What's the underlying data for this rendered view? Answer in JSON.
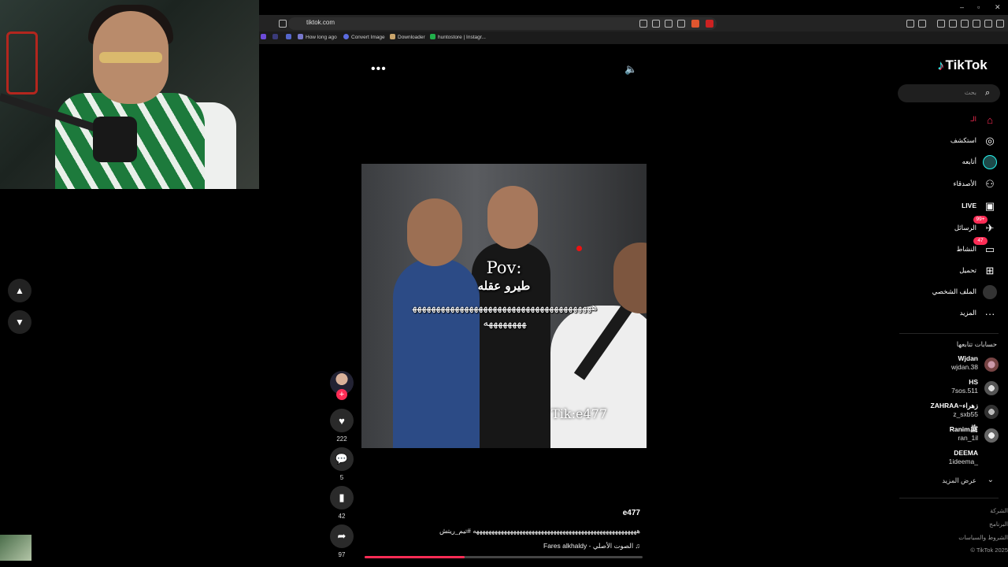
{
  "browser": {
    "url": "tiktok.com",
    "bookmarks": [
      "How long ago",
      "Convert Image",
      "Downloader",
      "huntostore | Instagr..."
    ]
  },
  "video": {
    "overlay_pov": "Pov:",
    "overlay_caption": "طيرو عقله",
    "overlay_laugh": "هههههههههههههههههههههههههههههههههههههههههههههههه",
    "watermark": "Tik:e477",
    "username": "e477",
    "description": "هههههههههههههههههههههههههههههههههههههههههههههههههههههه #تيم_ريتش",
    "music_icon": "music-note-icon",
    "music": "Fares alkhaldy - الصوت الأصلي",
    "progress": 0.36
  },
  "actions": {
    "likes": "222",
    "comments": "5",
    "saves": "42",
    "shares": "97"
  },
  "sidebar": {
    "logo": "TikTok",
    "search_placeholder": "بحث",
    "nav": [
      {
        "label": "الـ",
        "icon": "home-icon"
      },
      {
        "label": "استكشف",
        "icon": "compass-icon"
      },
      {
        "label": "أتابعه",
        "icon": "following-icon"
      },
      {
        "label": "الأصدقاء",
        "icon": "friends-icon"
      },
      {
        "label": "LIVE",
        "icon": "live-icon"
      },
      {
        "label": "الرسائل",
        "icon": "messages-icon",
        "badge": "99+"
      },
      {
        "label": "النشاط",
        "icon": "activity-icon",
        "badge": "47"
      },
      {
        "label": "تحميل",
        "icon": "upload-icon"
      },
      {
        "label": "الملف الشخصي",
        "icon": "profile-icon"
      },
      {
        "label": "المزيد",
        "icon": "more-icon"
      }
    ],
    "following_title": "حسابات تتابعها",
    "accounts": [
      {
        "name": "Wjdan",
        "handle": "wjdan.38"
      },
      {
        "name": "HS",
        "handle": "7sos.511"
      },
      {
        "name": "ZAHRAA~زهراء",
        "handle": "z_sxb55"
      },
      {
        "name": "Ranimﷺ",
        "handle": "ran_1il"
      },
      {
        "name": "DEEMA",
        "handle": "1ideema_"
      }
    ],
    "see_more": "عرض المزيد",
    "footer": [
      "الشركة",
      "البرنامج",
      "الشروط والسياسات",
      "© TikTok 2025"
    ]
  },
  "colors": {
    "accent": "#fe2c55",
    "background": "#000000"
  }
}
